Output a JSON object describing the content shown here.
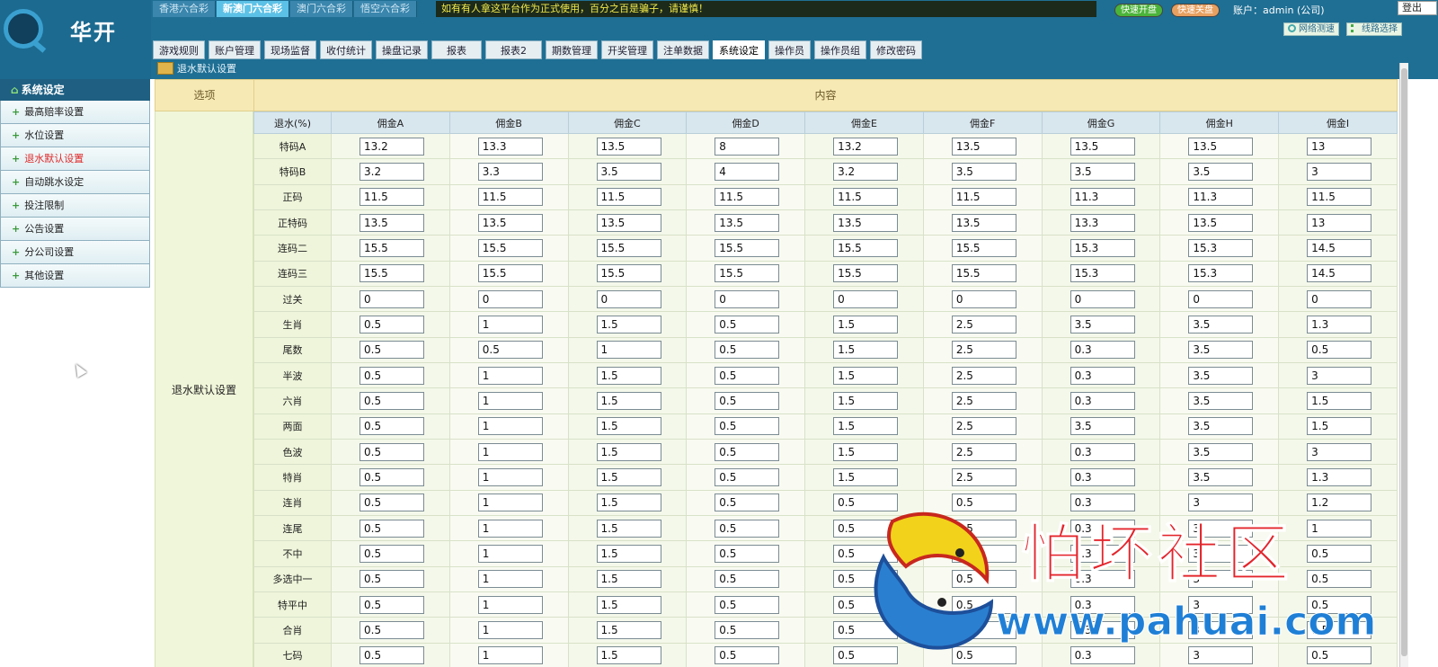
{
  "header": {
    "logo_text": "华开",
    "lottery_tabs": [
      {
        "label": "香港六合彩",
        "active": false
      },
      {
        "label": "新澳门六合彩",
        "active": true
      },
      {
        "label": "澳门六合彩",
        "active": false
      },
      {
        "label": "悟空六合彩",
        "active": false
      }
    ],
    "notice": "如有有人拿这平台作为正式使用，百分之百是骗子，请谨慎！",
    "quick_open": "快速开盘",
    "quick_close": "快速关盘",
    "account": "账户：admin (公司)",
    "logout": "登出",
    "network_test": "网络测速",
    "line_select": "线路选择"
  },
  "menu": [
    {
      "label": "游戏规则",
      "active": false
    },
    {
      "label": "账户管理",
      "active": false
    },
    {
      "label": "现场监督",
      "active": false
    },
    {
      "label": "收付统计",
      "active": false
    },
    {
      "label": "操盘记录",
      "active": false
    },
    {
      "label": "报表",
      "active": false
    },
    {
      "label": "报表2",
      "active": false
    },
    {
      "label": "期数管理",
      "active": false
    },
    {
      "label": "开奖管理",
      "active": false
    },
    {
      "label": "注单数据",
      "active": false
    },
    {
      "label": "系统设定",
      "active": true
    },
    {
      "label": "操作员",
      "active": false
    },
    {
      "label": "操作员组",
      "active": false
    },
    {
      "label": "修改密码",
      "active": false
    }
  ],
  "breadcrumb": "退水默认设置",
  "sidebar": {
    "title": "系统设定",
    "items": [
      {
        "label": "最高赔率设置",
        "active": false
      },
      {
        "label": "水位设置",
        "active": false
      },
      {
        "label": "退水默认设置",
        "active": true
      },
      {
        "label": "自动跳水设定",
        "active": false
      },
      {
        "label": "投注限制",
        "active": false
      },
      {
        "label": "公告设置",
        "active": false
      },
      {
        "label": "分公司设置",
        "active": false
      },
      {
        "label": "其他设置",
        "active": false
      }
    ]
  },
  "table": {
    "col_option": "选项",
    "col_content": "内容",
    "section_label": "退水默认设置",
    "headers": [
      "退水(%)",
      "佣金A",
      "佣金B",
      "佣金C",
      "佣金D",
      "佣金E",
      "佣金F",
      "佣金G",
      "佣金H",
      "佣金I"
    ],
    "rows": [
      {
        "label": "特码A",
        "values": [
          "13.2",
          "13.3",
          "13.5",
          "8",
          "13.2",
          "13.5",
          "13.5",
          "13.5",
          "13"
        ]
      },
      {
        "label": "特码B",
        "values": [
          "3.2",
          "3.3",
          "3.5",
          "4",
          "3.2",
          "3.5",
          "3.5",
          "3.5",
          "3"
        ]
      },
      {
        "label": "正码",
        "values": [
          "11.5",
          "11.5",
          "11.5",
          "11.5",
          "11.5",
          "11.5",
          "11.3",
          "11.3",
          "11.5"
        ]
      },
      {
        "label": "正特码",
        "values": [
          "13.5",
          "13.5",
          "13.5",
          "13.5",
          "13.5",
          "13.5",
          "13.3",
          "13.5",
          "13"
        ]
      },
      {
        "label": "连码二",
        "values": [
          "15.5",
          "15.5",
          "15.5",
          "15.5",
          "15.5",
          "15.5",
          "15.3",
          "15.3",
          "14.5"
        ]
      },
      {
        "label": "连码三",
        "values": [
          "15.5",
          "15.5",
          "15.5",
          "15.5",
          "15.5",
          "15.5",
          "15.3",
          "15.3",
          "14.5"
        ]
      },
      {
        "label": "过关",
        "values": [
          "0",
          "0",
          "0",
          "0",
          "0",
          "0",
          "0",
          "0",
          "0"
        ]
      },
      {
        "label": "生肖",
        "values": [
          "0.5",
          "1",
          "1.5",
          "0.5",
          "1.5",
          "2.5",
          "3.5",
          "3.5",
          "1.3"
        ]
      },
      {
        "label": "尾数",
        "values": [
          "0.5",
          "0.5",
          "1",
          "0.5",
          "1.5",
          "2.5",
          "0.3",
          "3.5",
          "0.5"
        ]
      },
      {
        "label": "半波",
        "values": [
          "0.5",
          "1",
          "1.5",
          "0.5",
          "1.5",
          "2.5",
          "0.3",
          "3.5",
          "3"
        ]
      },
      {
        "label": "六肖",
        "values": [
          "0.5",
          "1",
          "1.5",
          "0.5",
          "1.5",
          "2.5",
          "0.3",
          "3.5",
          "1.5"
        ]
      },
      {
        "label": "两面",
        "values": [
          "0.5",
          "1",
          "1.5",
          "0.5",
          "1.5",
          "2.5",
          "3.5",
          "3.5",
          "1.5"
        ]
      },
      {
        "label": "色波",
        "values": [
          "0.5",
          "1",
          "1.5",
          "0.5",
          "1.5",
          "2.5",
          "0.3",
          "3.5",
          "3"
        ]
      },
      {
        "label": "特肖",
        "values": [
          "0.5",
          "1",
          "1.5",
          "0.5",
          "1.5",
          "2.5",
          "0.3",
          "3.5",
          "1.3"
        ]
      },
      {
        "label": "连肖",
        "values": [
          "0.5",
          "1",
          "1.5",
          "0.5",
          "0.5",
          "0.5",
          "0.3",
          "3",
          "1.2"
        ]
      },
      {
        "label": "连尾",
        "values": [
          "0.5",
          "1",
          "1.5",
          "0.5",
          "0.5",
          "0.5",
          "0.3",
          "3",
          "1"
        ]
      },
      {
        "label": "不中",
        "values": [
          "0.5",
          "1",
          "1.5",
          "0.5",
          "0.5",
          "0.5",
          "0.3",
          "3",
          "0.5"
        ]
      },
      {
        "label": "多选中一",
        "values": [
          "0.5",
          "1",
          "1.5",
          "0.5",
          "0.5",
          "0.5",
          "0.3",
          "3",
          "0.5"
        ]
      },
      {
        "label": "特平中",
        "values": [
          "0.5",
          "1",
          "1.5",
          "0.5",
          "0.5",
          "0.5",
          "0.3",
          "3",
          "0.5"
        ]
      },
      {
        "label": "合肖",
        "values": [
          "0.5",
          "1",
          "1.5",
          "0.5",
          "0.5",
          "0.5",
          "0.3",
          "3",
          "0.5"
        ]
      },
      {
        "label": "七码",
        "values": [
          "0.5",
          "1",
          "1.5",
          "0.5",
          "0.5",
          "0.5",
          "0.3",
          "3",
          "0.5"
        ]
      }
    ]
  },
  "watermark": {
    "text": "怕坏社区",
    "url": "www.pahuai.com"
  }
}
